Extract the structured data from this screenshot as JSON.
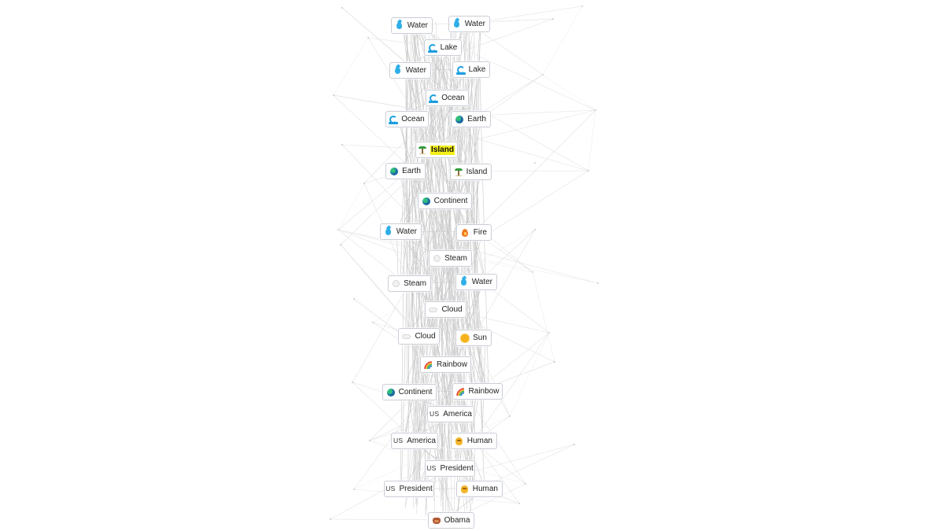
{
  "app": "Infinite Craft recipe graph",
  "highlight_color": "#f4ef1a",
  "cards": [
    {
      "label": "Water",
      "icon": "water-drop-icon"
    },
    {
      "label": "Water",
      "icon": "water-drop-icon"
    },
    {
      "label": "Lake",
      "icon": "wave-icon"
    },
    {
      "label": "Water",
      "icon": "water-drop-icon"
    },
    {
      "label": "Lake",
      "icon": "wave-icon"
    },
    {
      "label": "Ocean",
      "icon": "wave-icon"
    },
    {
      "label": "Ocean",
      "icon": "wave-icon"
    },
    {
      "label": "Earth",
      "icon": "globe-icon"
    },
    {
      "label": "Island",
      "icon": "island-icon",
      "highlighted": true
    },
    {
      "label": "Earth",
      "icon": "globe-icon"
    },
    {
      "label": "Island",
      "icon": "island-icon"
    },
    {
      "label": "Continent",
      "icon": "globe-icon"
    },
    {
      "label": "Water",
      "icon": "water-drop-icon"
    },
    {
      "label": "Fire",
      "icon": "fire-icon"
    },
    {
      "label": "Steam",
      "icon": "steam-icon"
    },
    {
      "label": "Steam",
      "icon": "steam-icon"
    },
    {
      "label": "Water",
      "icon": "water-drop-icon"
    },
    {
      "label": "Cloud",
      "icon": "cloud-icon"
    },
    {
      "label": "Cloud",
      "icon": "cloud-icon"
    },
    {
      "label": "Sun",
      "icon": "sun-icon"
    },
    {
      "label": "Rainbow",
      "icon": "rainbow-icon"
    },
    {
      "label": "Continent",
      "icon": "globe-icon"
    },
    {
      "label": "Rainbow",
      "icon": "rainbow-icon"
    },
    {
      "label": "America",
      "icon": "us-flag-icon",
      "icon_text": "US"
    },
    {
      "label": "America",
      "icon": "us-flag-icon",
      "icon_text": "US"
    },
    {
      "label": "Human",
      "icon": "human-icon"
    },
    {
      "label": "President",
      "icon": "us-flag-icon",
      "icon_text": "US"
    },
    {
      "label": "President",
      "icon": "us-flag-icon",
      "icon_text": "US"
    },
    {
      "label": "Human",
      "icon": "human-icon"
    },
    {
      "label": "Obama",
      "icon": "bear-face-icon"
    }
  ]
}
